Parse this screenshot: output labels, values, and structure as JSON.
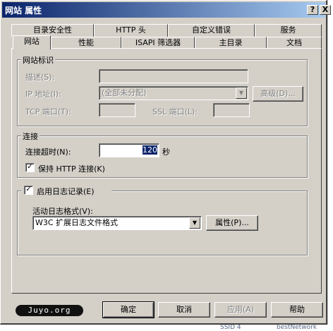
{
  "window": {
    "title": "网站 属性",
    "help_btn": "?",
    "close_btn": "X"
  },
  "tabs_back": [
    {
      "label": "目录安全性"
    },
    {
      "label": "HTTP 头"
    },
    {
      "label": "自定义错误"
    },
    {
      "label": "服务"
    }
  ],
  "tabs_front": [
    {
      "label": "网站"
    },
    {
      "label": "性能"
    },
    {
      "label": "ISAPI 筛选器"
    },
    {
      "label": "主目录"
    },
    {
      "label": "文档"
    }
  ],
  "identity": {
    "legend": "网站标识",
    "desc_label": "描述(S):",
    "desc_value": "",
    "ip_label": "IP 地址(I):",
    "ip_value": "(全部未分配)",
    "advanced_btn": "高级(D)...",
    "tcp_label": "TCP 端口(T):",
    "tcp_value": "",
    "ssl_label": "SSL 端口(L):",
    "ssl_value": ""
  },
  "connection": {
    "legend": "连接",
    "timeout_label": "连接超时(N):",
    "timeout_value": "120",
    "timeout_unit": "秒",
    "keepalive_label": "保持 HTTP 连接(K)",
    "keepalive_checked": true
  },
  "logging": {
    "enable_label": "启用日志记录(E)",
    "enable_checked": true,
    "format_label": "活动日志格式(V):",
    "format_value": "W3C 扩展日志文件格式",
    "props_btn": "属性(P)..."
  },
  "footer": {
    "logo": "Juyo.org",
    "ok": "确定",
    "cancel": "取消",
    "apply": "应用(A)",
    "help": "帮助"
  },
  "background": {
    "left_text": "SSID 4",
    "right_text": "bestNetwork"
  }
}
